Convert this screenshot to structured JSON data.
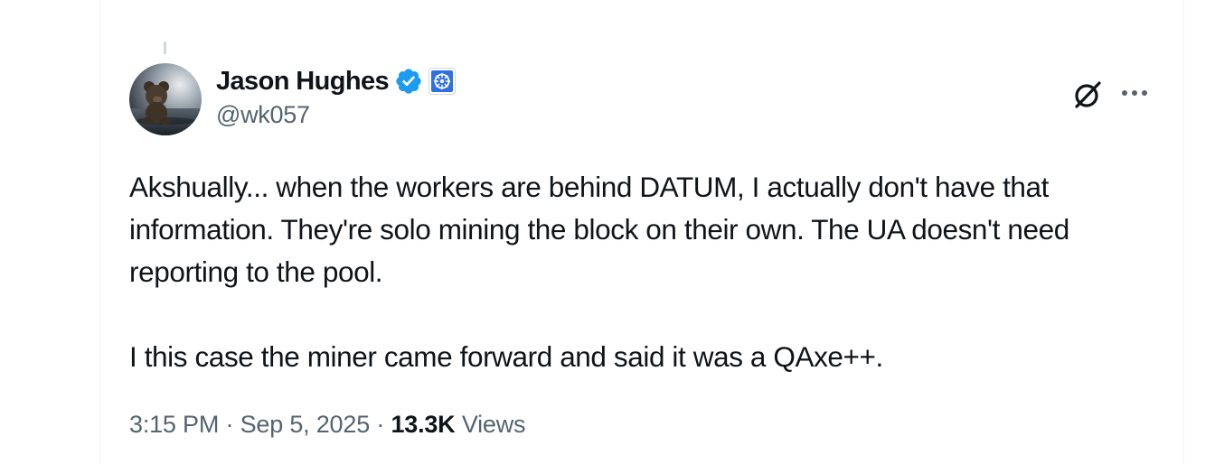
{
  "author": {
    "display_name": "Jason Hughes",
    "handle": "@wk057",
    "verified": true,
    "avatar_icon": "teddy-bear-avatar",
    "affiliate_badge_icon": "affiliate-badge-icon"
  },
  "toolbar": {
    "grok_icon": "grok-icon",
    "more_icon": "more-icon"
  },
  "tweet": {
    "paragraphs": [
      "Akshually... when the workers are behind DATUM, I actually don't have that information. They're solo mining the block on their own. The UA doesn't need reporting to the pool.",
      "I this case the miner came forward and said it was a QAxe++."
    ]
  },
  "meta": {
    "time": "3:15 PM",
    "separator": "·",
    "date": "Sep 5, 2025",
    "views_count": "13.3K",
    "views_label": "Views"
  },
  "colors": {
    "verified": "#1d9bf0",
    "text_primary": "#0f1419",
    "text_secondary": "#536471",
    "border": "#eff3f4"
  }
}
